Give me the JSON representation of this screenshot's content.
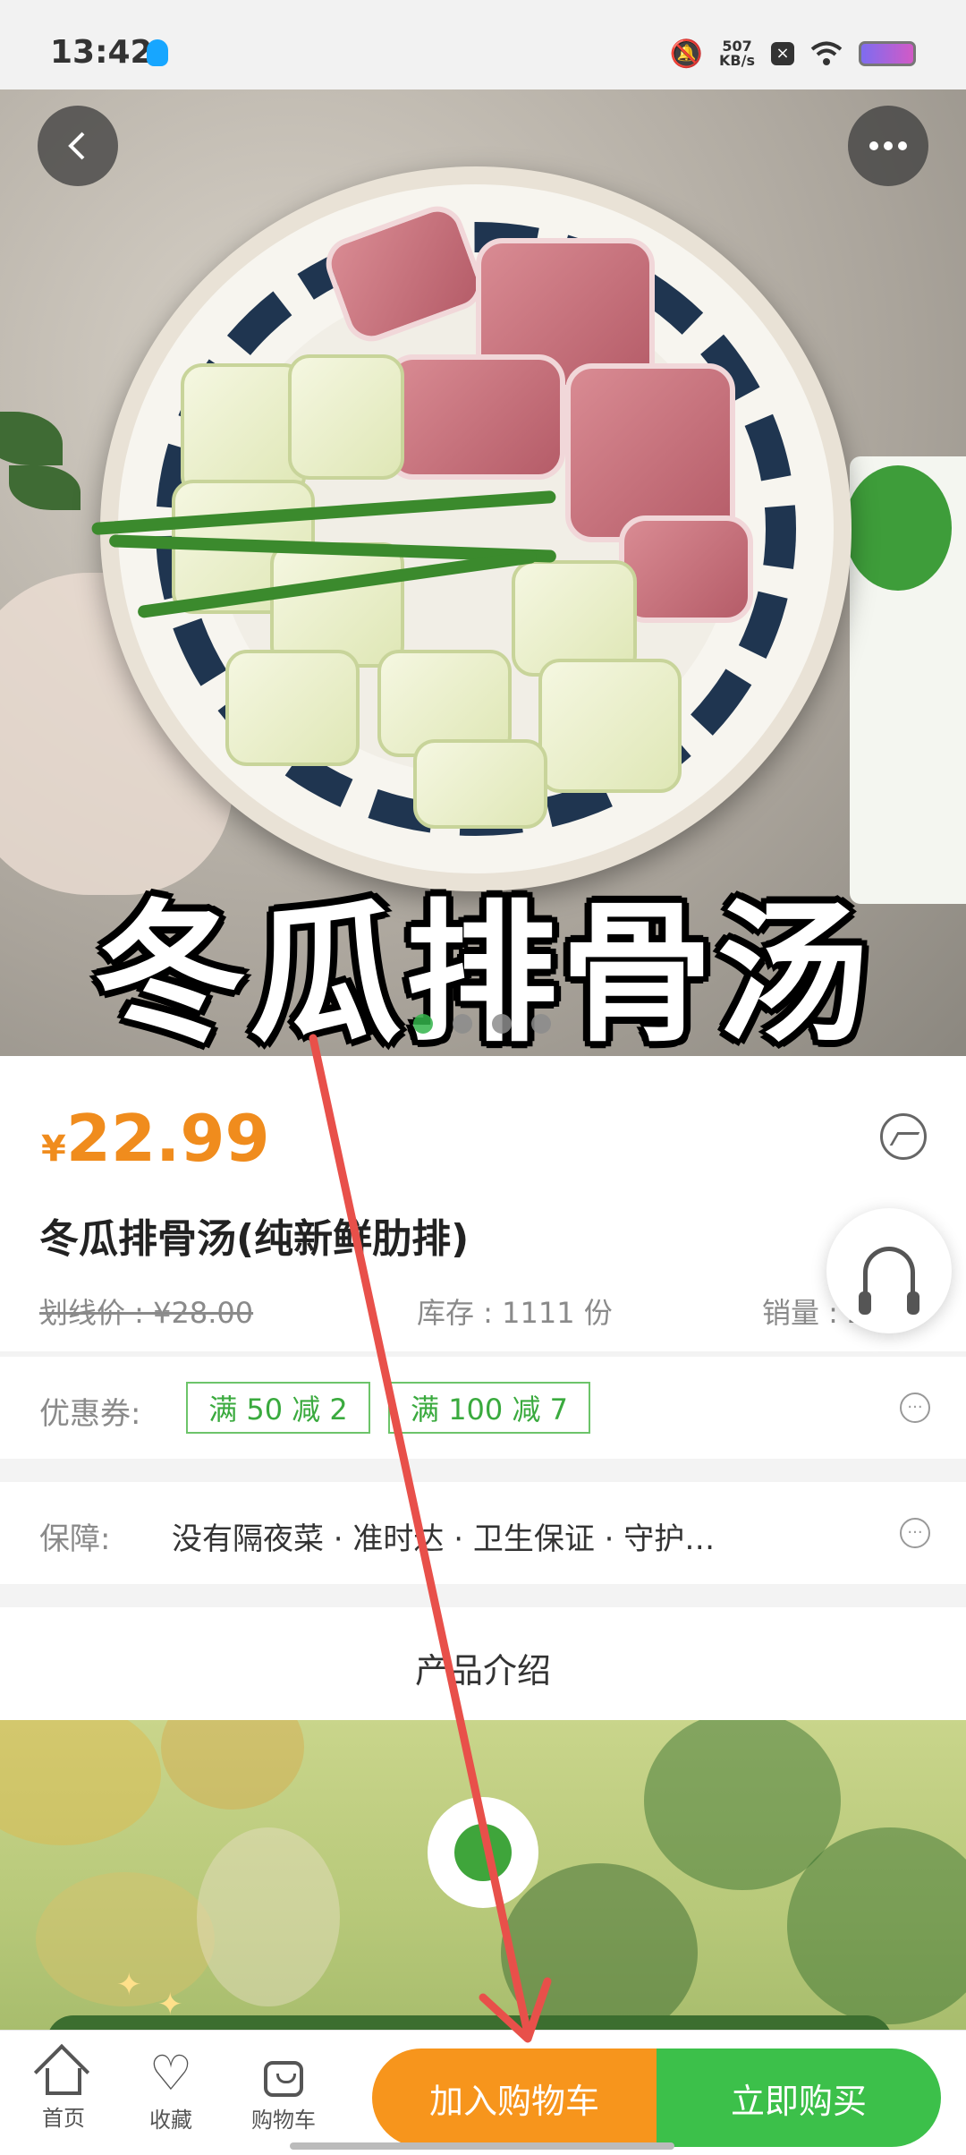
{
  "status_bar": {
    "time": "13:42",
    "net_speed_value": "507",
    "net_speed_unit": "KB/s",
    "icons": [
      "qq-icon",
      "mute-icon",
      "data-saver-icon",
      "wifi-icon",
      "battery-icon"
    ]
  },
  "hero": {
    "overlay_title": "冬瓜排骨汤",
    "slide_count": 4,
    "active_slide": 1,
    "icons": [
      "back-icon",
      "more-icon"
    ]
  },
  "product": {
    "currency": "¥",
    "price": "22.99",
    "name": "冬瓜排骨汤(纯新鲜肋排)",
    "original_price": "划线价 : ¥28.00",
    "stock": "库存 : 1111 份",
    "sales": "销量 : 2…"
  },
  "coupons": {
    "label": "优惠券:",
    "items": [
      "满 50 减 2",
      "满 100 减 7"
    ]
  },
  "guarantee": {
    "label": "保障:",
    "text": "没有隔夜菜 · 准时达 · 卫生保证 · 守护…"
  },
  "intro": {
    "title": "产品介绍"
  },
  "bottom_bar": {
    "home": "首页",
    "favorite": "收藏",
    "cart": "购物车",
    "add_to_cart": "加入购物车",
    "buy_now": "立即购买"
  },
  "colors": {
    "accent_orange": "#f7951c",
    "accent_green": "#3cc04a",
    "price_orange": "#f08c1d",
    "annotation_red": "#e8504a"
  }
}
